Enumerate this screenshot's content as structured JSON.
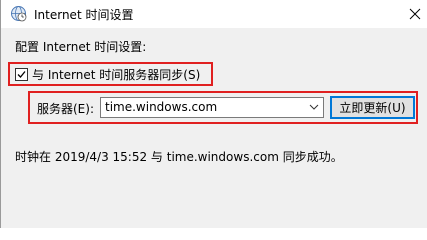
{
  "window": {
    "title": "Internet 时间设置",
    "icon": "clock-globe-icon",
    "close_icon": "close-icon"
  },
  "settings": {
    "section_label": "配置 Internet 时间设置:",
    "sync_checkbox_label": "与 Internet 时间服务器同步(S)",
    "sync_checked": true,
    "server_label": "服务器(E):",
    "server_value": "time.windows.com",
    "update_button_label": "立即更新(U)",
    "status_text": "时钟在 2019/4/3 15:52 与 time.windows.com 同步成功。"
  },
  "colors": {
    "highlight_border": "#e02020",
    "button_focus": "#0078d7",
    "dialog_background": "#f0f0f0"
  }
}
